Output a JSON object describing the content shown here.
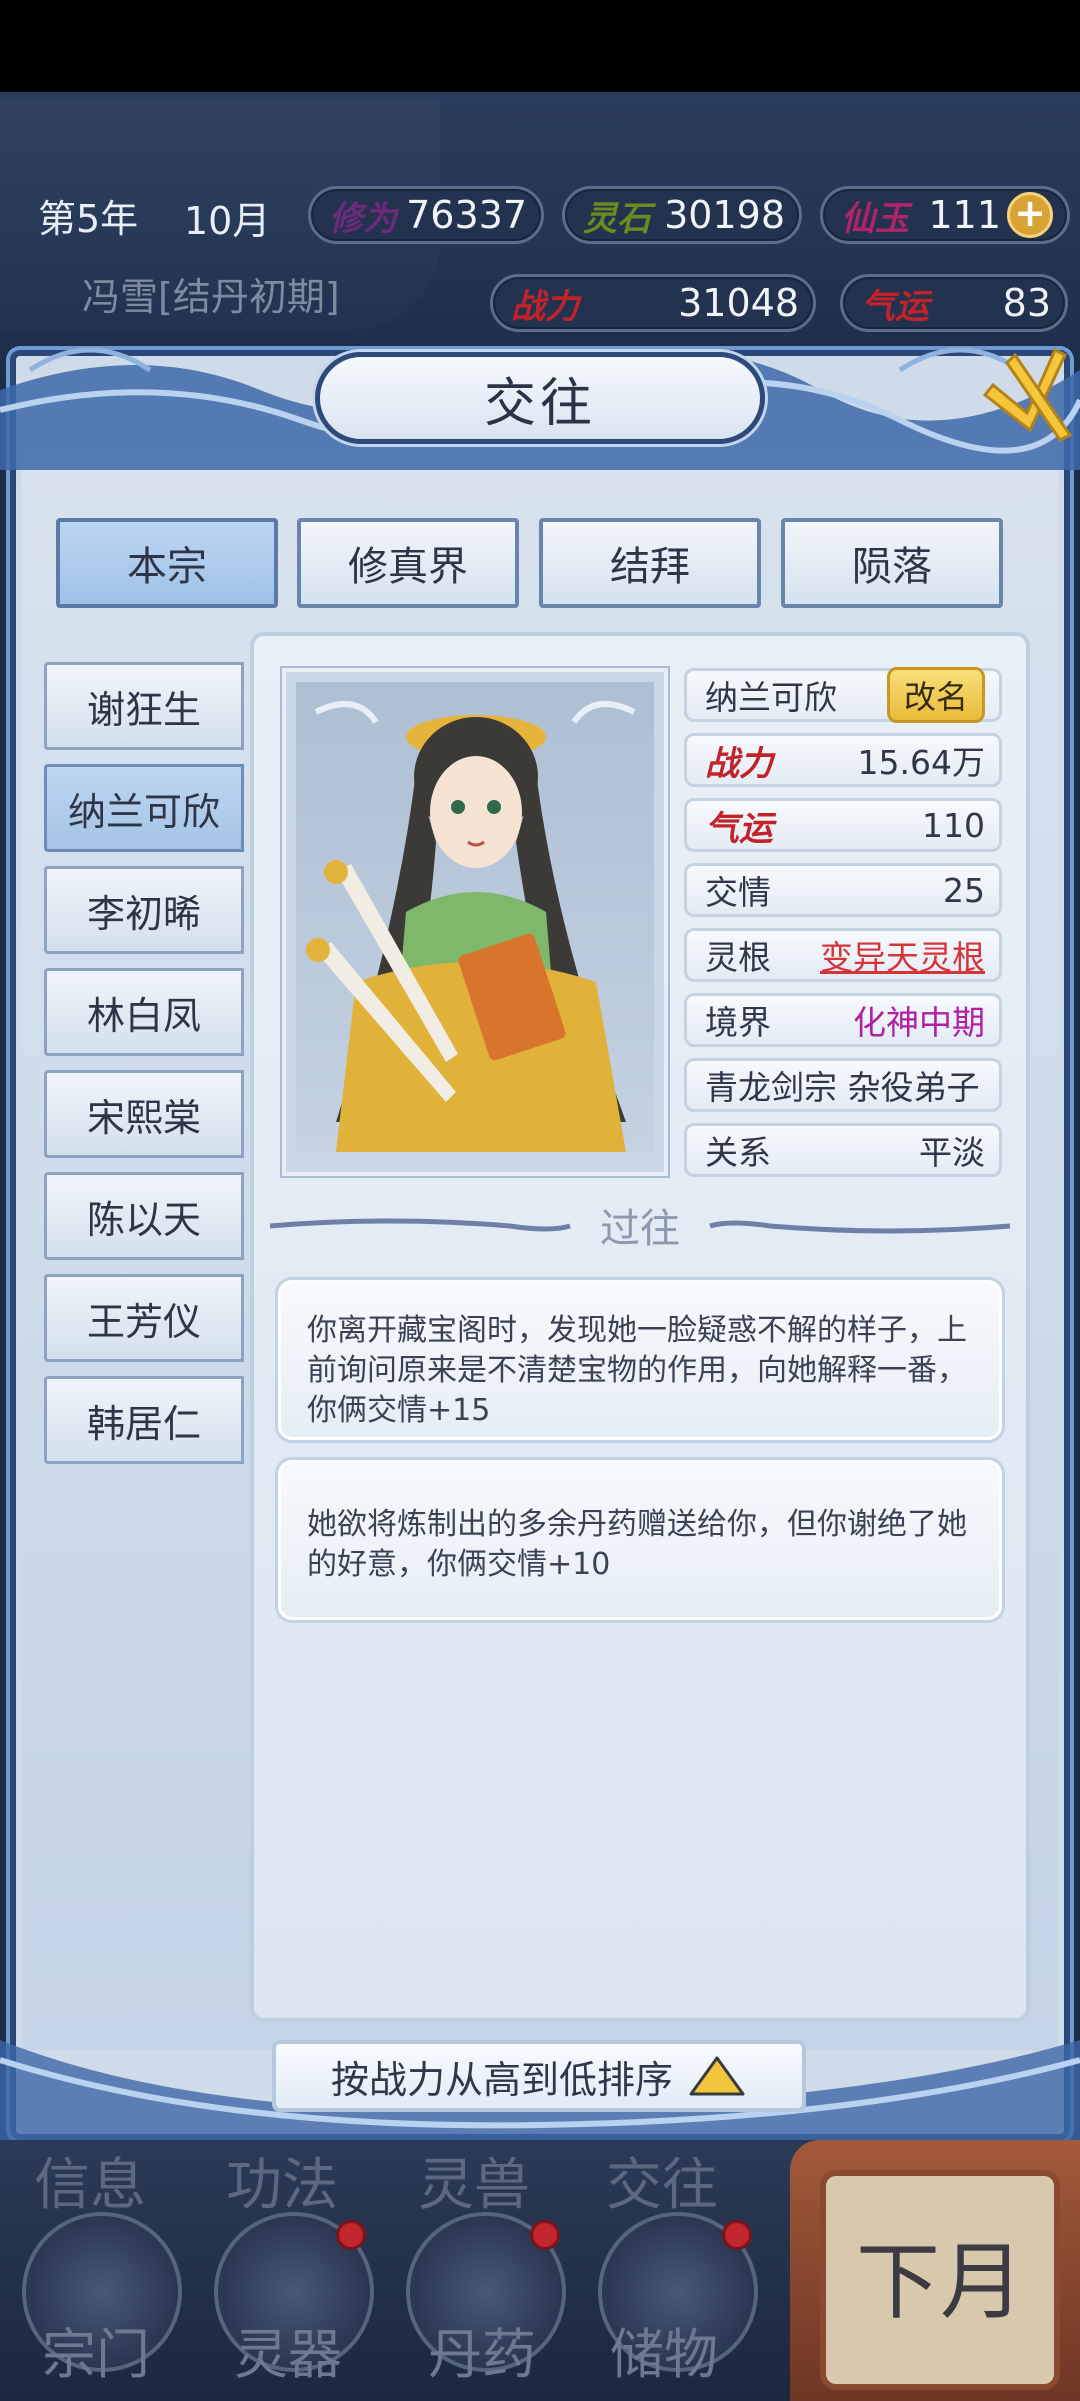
{
  "hud": {
    "year": "第5年",
    "month": "10月",
    "player": "冯雪[结丹初期]",
    "stats": {
      "cultivation": {
        "label": "修为",
        "value": "76337"
      },
      "spirit_stone": {
        "label": "灵石",
        "value": "30198"
      },
      "immortal_jade": {
        "label": "仙玉",
        "value": "111"
      },
      "combat": {
        "label": "战力",
        "value": "31048"
      },
      "luck": {
        "label": "气运",
        "value": "83"
      }
    }
  },
  "title": "交往",
  "tabs": [
    "本宗",
    "修真界",
    "结拜",
    "陨落"
  ],
  "people": [
    "谢狂生",
    "纳兰可欣",
    "李初晞",
    "林白凤",
    "宋熙棠",
    "陈以天",
    "王芳仪",
    "韩居仁"
  ],
  "detail": {
    "name": "纳兰可欣",
    "rename_label": "改名",
    "rows": [
      {
        "label": "战力",
        "value": "15.64万"
      },
      {
        "label": "气运",
        "value": "110"
      },
      {
        "label": "交情",
        "value": "25"
      },
      {
        "label": "灵根",
        "value": "变异天灵根"
      },
      {
        "label": "境界",
        "value": "化神中期"
      },
      {
        "label": "",
        "value": "青龙剑宗 杂役弟子"
      },
      {
        "label": "关系",
        "value": "平淡"
      }
    ],
    "history_title": "过往",
    "history": [
      "你离开藏宝阁时，发现她一脸疑惑不解的样子，上前询问原来是不清楚宝物的作用，向她解释一番，你俩交情+15",
      "她欲将炼制出的多余丹药赠送给你，但你谢绝了她的好意，你俩交情+10"
    ]
  },
  "sort_label": "按战力从高到低排序",
  "bottom_nav": {
    "top_labels": [
      "信息",
      "功法",
      "灵兽",
      "交往"
    ],
    "items": [
      "宗门",
      "灵器",
      "丹药",
      "储物"
    ],
    "next_month": "下月"
  },
  "colors": {
    "frame_blue": "#2a4778",
    "active_tab": "#a6c6e8",
    "rename_gold": "#e8bd3a",
    "combat_red": "#c2232a",
    "cultivation_purple": "#6b2a7a",
    "spirit_green": "#6b8a20",
    "root_red": "#d4343a",
    "realm_magenta": "#b01fa6"
  }
}
